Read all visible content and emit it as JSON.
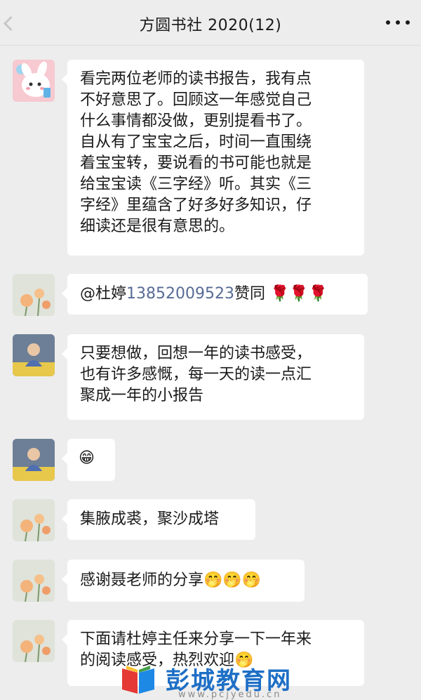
{
  "header": {
    "title": "方圆书社 2020(12)",
    "back_icon": "chevron-left-icon",
    "more_icon": "more-dots-icon"
  },
  "messages": [
    {
      "avatar": "rabbit-avatar",
      "lines": [
        "看完两位老师的读书报告，我有点",
        "不好意思了。回顾这一年感觉自己",
        "什么事情都没做，更别提看书了。",
        "自从有了宝宝之后，时间一直围绕",
        "着宝宝转，要说看的书可能也就是",
        "给宝宝读《三字经》听。其实《三",
        "字经》里蕴含了好多好多知识，仔",
        "细读还是很有意思的。"
      ]
    },
    {
      "avatar": "flower-avatar",
      "mention": "@杜婷",
      "phone": "13852009523",
      "text_after": "赞同",
      "emoji": "🌹🌹🌹"
    },
    {
      "avatar": "person-avatar",
      "lines": [
        "只要想做，回想一年的读书感受，",
        "也有许多感慨，每一天的读一点汇",
        "聚成一年的小报告"
      ]
    },
    {
      "avatar": "person-avatar",
      "emoji": "😁"
    },
    {
      "avatar": "flower-avatar",
      "lines": [
        "集腋成裘，聚沙成塔"
      ]
    },
    {
      "avatar": "flower-avatar",
      "text": "感谢聂老师的分享",
      "emoji": "🤭🤭🤭"
    },
    {
      "avatar": "flower-avatar",
      "lines": [
        "下面请杜婷主任来分享一下一年来",
        "的阅读感受，热烈欢迎"
      ],
      "emoji": "🤭"
    }
  ],
  "watermark": {
    "name": "彭城教育网",
    "url": "www.pcjyedu.cn",
    "logo_colors": [
      "#e53935",
      "#fbc02d",
      "#43a047",
      "#1e88e5"
    ]
  }
}
